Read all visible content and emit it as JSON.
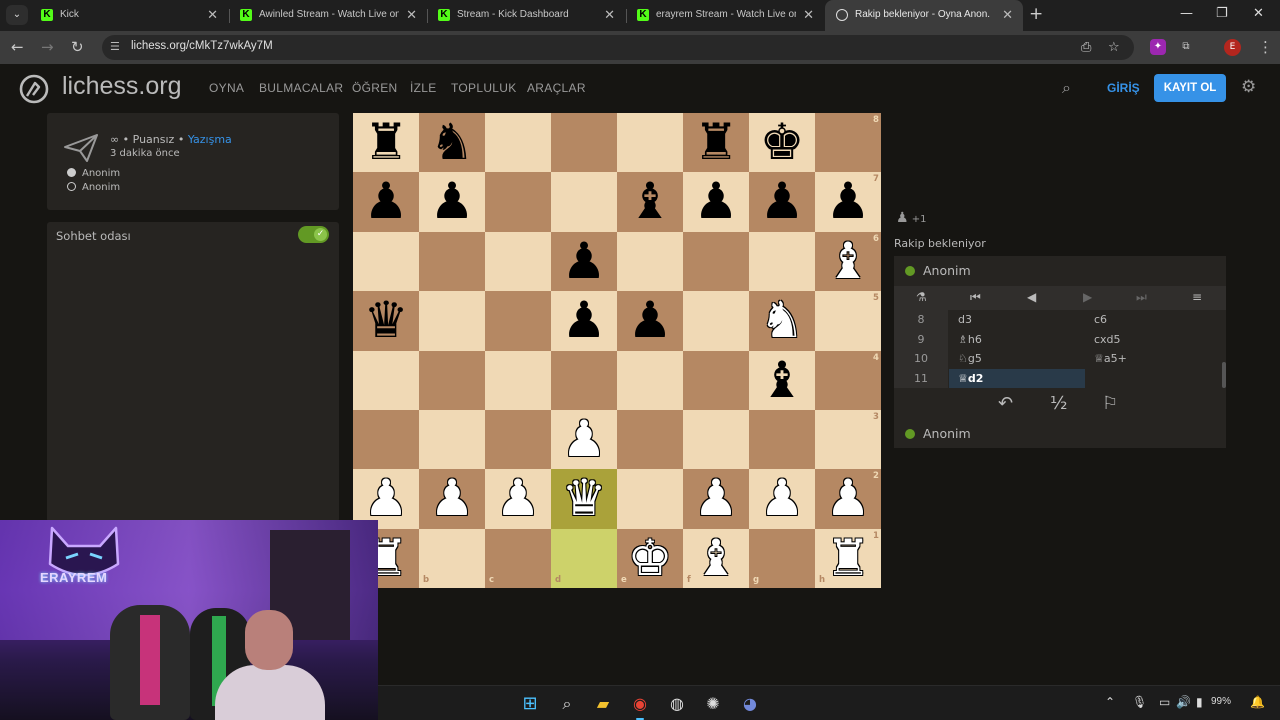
{
  "browser": {
    "tabs": [
      {
        "title": "Kick",
        "icon": "kick-icon",
        "active": false
      },
      {
        "title": "Awinled Stream - Watch Live on",
        "icon": "kick-icon",
        "active": false
      },
      {
        "title": "Stream - Kick Dashboard",
        "icon": "kick-icon",
        "active": false
      },
      {
        "title": "erayrem Stream - Watch Live on",
        "icon": "kick-icon",
        "active": false
      },
      {
        "title": "Rakip bekleniyor - Oyna Anon.",
        "icon": "lichess-icon",
        "active": true
      }
    ],
    "url": "lichess.org/cMkTz7wkAy7M",
    "profile_initial": "E"
  },
  "site": {
    "logo": "lichess.org",
    "nav": [
      "OYNA",
      "BULMACALAR",
      "ÖĞREN",
      "İZLE",
      "TOPLULUK",
      "ARAÇLAR"
    ],
    "login": "GİRİŞ",
    "signup": "KAYIT OL"
  },
  "game_meta": {
    "line1_prefix": "∞ • Puansız • ",
    "line1_link": "Yazışma",
    "time_ago": "3 dakika önce",
    "players": [
      {
        "name": "Anonim",
        "color": "white"
      },
      {
        "name": "Anonim",
        "color": "black"
      }
    ]
  },
  "chat": {
    "title": "Sohbet odası",
    "enabled": true
  },
  "board": {
    "files": [
      "a",
      "b",
      "c",
      "d",
      "e",
      "f",
      "g",
      "h"
    ],
    "ranks": [
      "8",
      "7",
      "6",
      "5",
      "4",
      "3",
      "2",
      "1"
    ],
    "highlight": [
      "d2",
      "d1"
    ],
    "pieces": {
      "a8": "bR",
      "b8": "bN",
      "f8": "bR",
      "g8": "bK",
      "a7": "bP",
      "b7": "bP",
      "e7": "bB",
      "f7": "bP",
      "g7": "bP",
      "h7": "bP",
      "d6": "bP",
      "h6": "wB",
      "a5": "bQ",
      "d5": "bP",
      "e5": "bP",
      "g5": "wN",
      "g4": "bB",
      "d3": "wP",
      "a2": "wP",
      "b2": "wP",
      "c2": "wP",
      "d2": "wQ",
      "f2": "wP",
      "g2": "wP",
      "h2": "wP",
      "a1": "wR",
      "e1": "wK",
      "f1": "wB",
      "h1": "wR"
    }
  },
  "panel": {
    "spectators": "+1",
    "status": "Rakip bekleniyor",
    "top_player": "Anonim",
    "bottom_player": "Anonim",
    "moves": [
      {
        "n": "8",
        "w": "d3",
        "b": "c6"
      },
      {
        "n": "9",
        "w": "♗h6",
        "b": "cxd5"
      },
      {
        "n": "10",
        "w": "♘g5",
        "b": "♕a5+"
      },
      {
        "n": "11",
        "w": "♕d2",
        "b": ""
      }
    ],
    "active_move": "11w",
    "draw_label": "½"
  },
  "stream_overlay": {
    "logo_text": "ERAYREM"
  },
  "taskbar": {
    "battery": "99%"
  }
}
